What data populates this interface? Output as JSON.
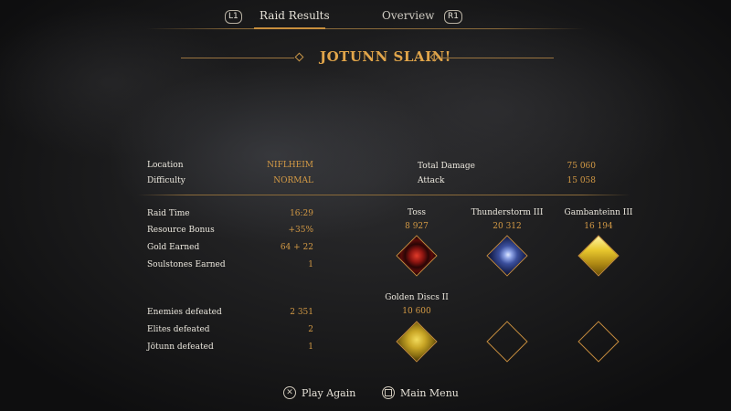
{
  "nav": {
    "left_button": "L1",
    "right_button": "R1",
    "tabs": [
      {
        "label": "Raid Results",
        "active": true
      },
      {
        "label": "Overview",
        "active": false
      }
    ]
  },
  "title": "JOTUNN SLAIN!",
  "summary": {
    "left": [
      {
        "label": "Location",
        "value": "NIFLHEIM"
      },
      {
        "label": "Difficulty",
        "value": "NORMAL"
      }
    ],
    "right": [
      {
        "label": "Total Damage",
        "value": "75 060"
      },
      {
        "label": "Attack",
        "value": "15 058"
      }
    ]
  },
  "stats": [
    {
      "label": "Raid Time",
      "value": "16:29"
    },
    {
      "label": "Resource Bonus",
      "value": "+35%"
    },
    {
      "label": "Gold Earned",
      "value": "64 + 22"
    },
    {
      "label": "Soulstones Earned",
      "value": "1"
    }
  ],
  "defeated": [
    {
      "label": "Enemies defeated",
      "value": "2 351"
    },
    {
      "label": "Elites defeated",
      "value": "2"
    },
    {
      "label": "Jötunn defeated",
      "value": "1"
    }
  ],
  "abilities": [
    {
      "name": "Toss",
      "damage": "8 927",
      "icon": "red-spiral-icon",
      "color": "#b3201c"
    },
    {
      "name": "Thunderstorm III",
      "damage": "20 312",
      "icon": "lightning-icon",
      "color": "#4c63b0"
    },
    {
      "name": "Gambanteinn III",
      "damage": "16 194",
      "icon": "gold-slash-icon",
      "color": "#d6b52a"
    },
    {
      "name": "Golden Discs II",
      "damage": "10 600",
      "icon": "golden-discs-icon",
      "color": "#c9a626"
    },
    {
      "name": "",
      "damage": "",
      "icon": "empty-slot",
      "color": ""
    },
    {
      "name": "",
      "damage": "",
      "icon": "empty-slot",
      "color": ""
    }
  ],
  "actions": {
    "play_again": "Play Again",
    "main_menu": "Main Menu",
    "play_again_icon": "✕"
  },
  "colors": {
    "accent": "#d9a24a",
    "line": "#9a7440"
  }
}
